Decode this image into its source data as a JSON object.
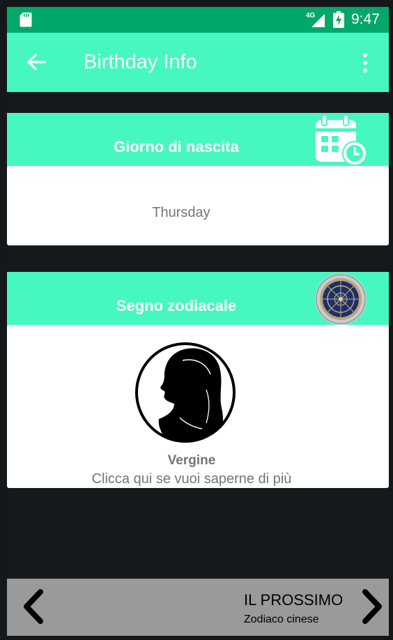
{
  "status_bar": {
    "network": "4G",
    "time": "9:47",
    "bg_color": "#02a86a"
  },
  "app_bar": {
    "title": "Birthday Info",
    "back_icon": "arrow-left-icon",
    "menu_icon": "more-vert-icon",
    "accent": "#46f8bf"
  },
  "birth_day": {
    "header": "Giorno di nascita",
    "icon": "calendar-clock-icon",
    "value": "Thursday"
  },
  "zodiac": {
    "header": "Segno zodiacale",
    "icon": "zodiac-wheel-icon",
    "sign": "Vergine",
    "sign_icon": "virgo-silhouette-icon",
    "more_text": "Clicca qui se vuoi saperne di più"
  },
  "bottom_nav": {
    "next_title": "IL PROSSIMO",
    "next_subtitle": "Zodiaco cinese",
    "prev_icon": "chevron-left-icon",
    "next_icon": "chevron-right-icon",
    "bg_color": "#9a9a9a"
  }
}
